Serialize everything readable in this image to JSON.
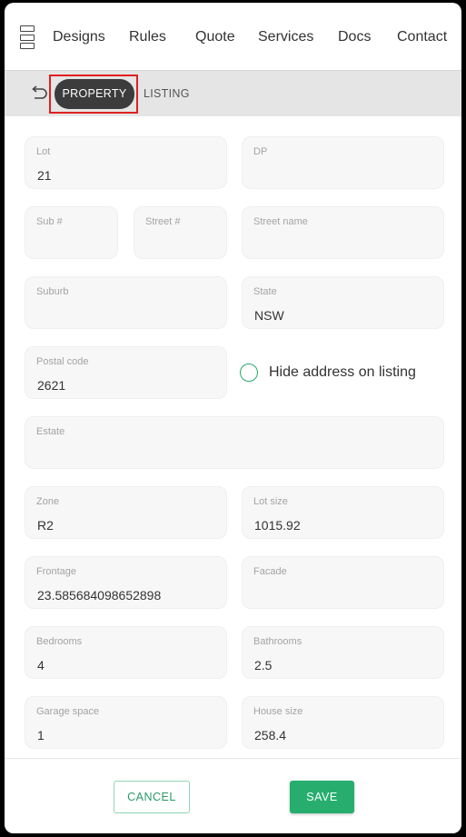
{
  "nav": {
    "items": [
      {
        "label": "Designs"
      },
      {
        "label": "Rules"
      },
      {
        "label": "Quote"
      },
      {
        "label": "Services"
      },
      {
        "label": "Docs"
      },
      {
        "label": "Contact"
      }
    ]
  },
  "tabs": {
    "property": "PROPERTY",
    "listing": "LISTING",
    "active": "PROPERTY"
  },
  "form": {
    "lot": {
      "label": "Lot",
      "value": "21"
    },
    "dp": {
      "label": "DP",
      "value": ""
    },
    "sub_no": {
      "label": "Sub #",
      "value": ""
    },
    "street_no": {
      "label": "Street #",
      "value": ""
    },
    "street_name": {
      "label": "Street name",
      "value": ""
    },
    "suburb": {
      "label": "Suburb",
      "value": ""
    },
    "state": {
      "label": "State",
      "value": "NSW"
    },
    "postal_code": {
      "label": "Postal code",
      "value": "2621"
    },
    "hide_address": {
      "label": "Hide address on listing",
      "checked": false
    },
    "estate": {
      "label": "Estate",
      "value": ""
    },
    "zone": {
      "label": "Zone",
      "value": "R2"
    },
    "lot_size": {
      "label": "Lot size",
      "value": "1015.92"
    },
    "frontage": {
      "label": "Frontage",
      "value": "23.585684098652898"
    },
    "facade": {
      "label": "Facade",
      "value": ""
    },
    "bedrooms": {
      "label": "Bedrooms",
      "value": "4"
    },
    "bathrooms": {
      "label": "Bathrooms",
      "value": "2.5"
    },
    "garage_space": {
      "label": "Garage space",
      "value": "1"
    },
    "house_size": {
      "label": "House size",
      "value": "258.4"
    }
  },
  "footer": {
    "cancel_label": "CANCEL",
    "save_label": "SAVE"
  },
  "colors": {
    "accent": "#27ae6f",
    "active_tab": "#3c3c3c",
    "highlight_outline": "#e02020"
  },
  "icons": {
    "menu": "grid-menu-icon",
    "back": "undo-arrow-icon"
  }
}
